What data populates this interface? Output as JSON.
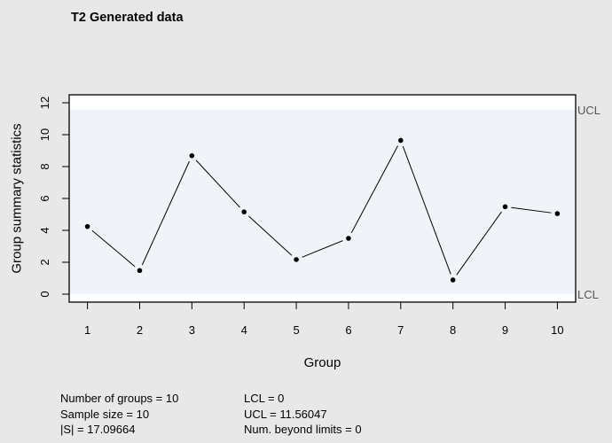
{
  "chart_data": {
    "type": "line",
    "title": "T2 Generated data",
    "xlabel": "Group",
    "ylabel": "Group summary statistics",
    "x": [
      1,
      2,
      3,
      4,
      5,
      6,
      7,
      8,
      9,
      10
    ],
    "series": [
      {
        "name": "Group summary statistics",
        "values": [
          4.24,
          1.48,
          8.68,
          5.16,
          2.17,
          3.5,
          9.64,
          0.89,
          5.48,
          5.05
        ]
      }
    ],
    "xlim": [
      0.65,
      10.35
    ],
    "ylim": [
      -0.5,
      12.5
    ],
    "xticks": [
      "1",
      "2",
      "3",
      "4",
      "5",
      "6",
      "7",
      "8",
      "9",
      "10"
    ],
    "yticks": [
      "0",
      "2",
      "4",
      "6",
      "8",
      "10",
      "12"
    ],
    "ytick_values": [
      0,
      2,
      4,
      6,
      8,
      10,
      12
    ],
    "limits": {
      "LCL": 0,
      "UCL": 11.56047,
      "lcl_label": "LCL",
      "ucl_label": "UCL"
    },
    "colors": {
      "band": "#f0f4f8",
      "plot_bg": "#ffffff",
      "page_bg": "#e8e8e8",
      "line": "#000000",
      "point": "#000000",
      "limit_label": "#555555"
    },
    "grid": false,
    "legend": "none"
  },
  "stats": {
    "left": [
      "Number of groups = 10",
      "Sample size = 10",
      "|S| = 17.09664"
    ],
    "right": [
      "LCL = 0",
      "UCL = 11.56047",
      "Num. beyond limits = 0"
    ]
  }
}
